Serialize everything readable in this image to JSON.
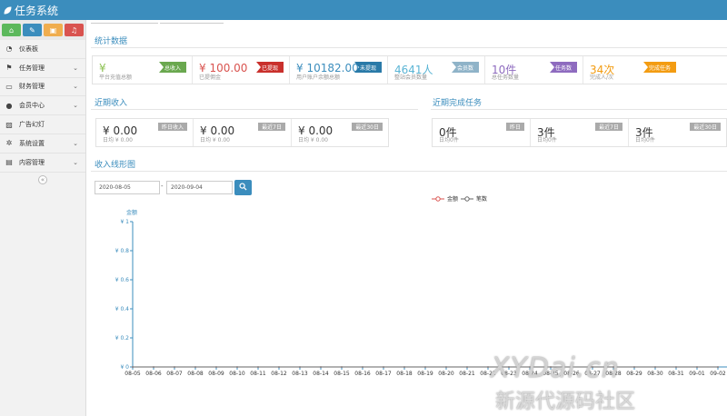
{
  "app": {
    "title": "任务系统"
  },
  "toolbar": {
    "buttons": [
      {
        "icon": "home-icon",
        "color": "#5cb85c"
      },
      {
        "icon": "pencil-icon",
        "color": "#3b8dbd"
      },
      {
        "icon": "briefcase-icon",
        "color": "#f0ad4e"
      },
      {
        "icon": "bell-icon",
        "color": "#d9534f"
      }
    ]
  },
  "sidebar": {
    "items": [
      {
        "label": "仪表板",
        "icon": "dashboard-icon",
        "has_children": false
      },
      {
        "label": "任务管理",
        "icon": "flag-icon",
        "has_children": true
      },
      {
        "label": "财务管理",
        "icon": "inbox-icon",
        "has_children": true
      },
      {
        "label": "会员中心",
        "icon": "user-icon",
        "has_children": true
      },
      {
        "label": "广告幻灯",
        "icon": "image-icon",
        "has_children": false
      },
      {
        "label": "系统设置",
        "icon": "gear-icon",
        "has_children": true
      },
      {
        "label": "内容管理",
        "icon": "book-icon",
        "has_children": true
      }
    ],
    "collapse_icon": "double-chevron-left-icon"
  },
  "stats": {
    "title": "统计数据",
    "cards": [
      {
        "value": "¥",
        "label": "平台充值总额",
        "tag": "总收入",
        "color": "#8cc152",
        "tag_color": "#6aa84f"
      },
      {
        "value": "¥ 100.00",
        "label": "已提佣金",
        "tag": "已提现",
        "color": "#d9534f",
        "tag_color": "#c9302c"
      },
      {
        "value": "¥ 10182.00",
        "label": "用户账户余额总额",
        "tag": "未提现",
        "color": "#3b8dbd",
        "tag_color": "#2a7aa8"
      },
      {
        "value": "4641人",
        "label": "整站会员数量",
        "tag": "会员数",
        "color": "#5bb5d5",
        "tag_color": "#8fb3c8"
      },
      {
        "value": "10件",
        "label": "总任务数量",
        "tag": "任务数",
        "color": "#8e6bbf",
        "tag_color": "#8e6bbf"
      },
      {
        "value": "34次",
        "label": "完成人/次",
        "tag": "完成任务",
        "color": "#f39c12",
        "tag_color": "#f39c12"
      }
    ]
  },
  "income": {
    "title": "近期收入",
    "cards": [
      {
        "value": "¥ 0.00",
        "label": "日均 ¥ 0.00",
        "tag": "昨日收入"
      },
      {
        "value": "¥ 0.00",
        "label": "日均 ¥ 0.00",
        "tag": "最近7日"
      },
      {
        "value": "¥ 0.00",
        "label": "日均 ¥ 0.00",
        "tag": "最近30日"
      }
    ]
  },
  "tasks": {
    "title": "近期完成任务",
    "cards": [
      {
        "value": "0件",
        "label": "日均0件",
        "tag": "昨日"
      },
      {
        "value": "3件",
        "label": "日均0件",
        "tag": "最近7日"
      },
      {
        "value": "3件",
        "label": "日均0件",
        "tag": "最近30日"
      }
    ]
  },
  "line": {
    "title": "收入线形图",
    "start_date": "2020-08-05",
    "end_date": "2020-09-04",
    "separator": "-",
    "search_icon": "search-icon"
  },
  "watermark": {
    "line1": "XYDai.cn",
    "line2": "新源代源码社区"
  },
  "chart_data": {
    "type": "line",
    "ylabel": "金额",
    "series": [
      {
        "name": "金额",
        "values": [
          0,
          0,
          0,
          0,
          0,
          0,
          0,
          0,
          0,
          0,
          0,
          0,
          0,
          0,
          0,
          0,
          0,
          0,
          0,
          0,
          0,
          0,
          0,
          0,
          0,
          0,
          0,
          0,
          0
        ],
        "color": "#d9534f"
      },
      {
        "name": "笔数",
        "values": [
          0,
          0,
          0,
          0,
          0,
          0,
          0,
          0,
          0,
          0,
          0,
          0,
          0,
          0,
          0,
          0,
          0,
          0,
          0,
          0,
          0,
          0,
          0,
          0,
          0,
          0,
          0,
          0,
          0
        ],
        "color": "#666666"
      }
    ],
    "categories": [
      "08-05",
      "08-06",
      "08-07",
      "08-08",
      "08-09",
      "08-10",
      "08-11",
      "08-12",
      "08-13",
      "08-14",
      "08-15",
      "08-16",
      "08-17",
      "08-18",
      "08-19",
      "08-20",
      "08-21",
      "08-22",
      "08-23",
      "08-24",
      "08-25",
      "08-26",
      "08-27",
      "08-28",
      "08-29",
      "08-30",
      "08-31",
      "09-01",
      "09-02"
    ],
    "yticks": [
      "¥ 0",
      "¥ 0.2",
      "¥ 0.4",
      "¥ 0.6",
      "¥ 0.8",
      "¥ 1"
    ],
    "ylim": [
      0,
      1
    ],
    "grid": false
  }
}
